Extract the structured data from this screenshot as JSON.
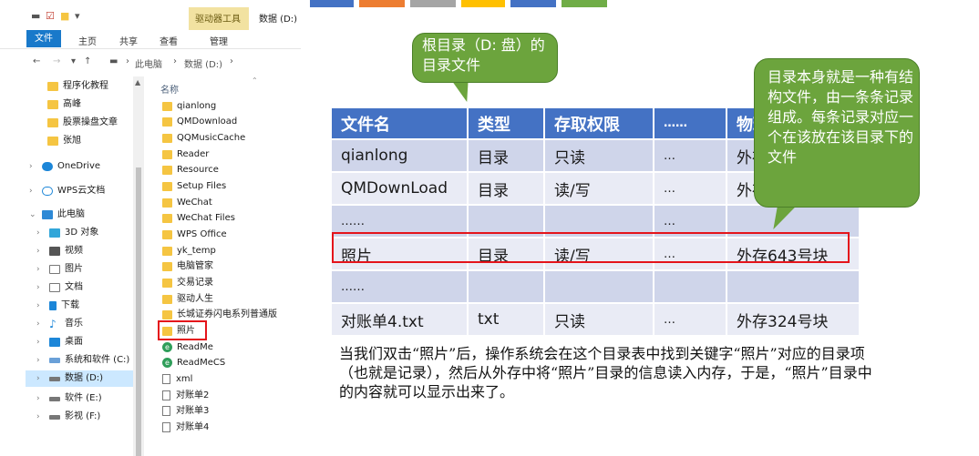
{
  "colors": {
    "accent_file_tab": "#1979ca",
    "table_header": "#4472c4",
    "table_row_odd": "#cfd5ea",
    "table_row_even": "#e9ebf5",
    "callout_green": "#6ca43d",
    "highlight_red": "#e4141b",
    "top_tabs": [
      "#4472c4",
      "#ed7d31",
      "#a5a5a5",
      "#ffc000",
      "#4472c4",
      "#70ad47"
    ]
  },
  "explorer": {
    "title_bar": {
      "quick_access_icons": [
        "save-icon",
        "properties-icon",
        "new-folder-icon",
        "customize-icon"
      ],
      "drive_tools": "驱动器工具",
      "window_title": "数据 (D:)"
    },
    "ribbon_tabs": {
      "file": "文件",
      "home": "主页",
      "share": "共享",
      "view": "查看",
      "manage": "管理"
    },
    "address": {
      "this_pc": "此电脑",
      "sep1": "›",
      "drive": "数据 (D:)",
      "sep2": "›"
    },
    "nav": [
      {
        "label": "程序化教程",
        "icon": "folder-icon"
      },
      {
        "label": "高峰",
        "icon": "folder-icon"
      },
      {
        "label": "股票操盘文章",
        "icon": "folder-icon"
      },
      {
        "label": "张旭",
        "icon": "folder-icon"
      },
      {
        "label": "OneDrive",
        "icon": "cloud-icon"
      },
      {
        "label": "WPS云文档",
        "icon": "cloud-outline-icon"
      },
      {
        "label": "此电脑",
        "icon": "computer-icon"
      },
      {
        "label": "3D 对象",
        "icon": "cube-icon"
      },
      {
        "label": "视频",
        "icon": "video-icon"
      },
      {
        "label": "图片",
        "icon": "picture-icon"
      },
      {
        "label": "文档",
        "icon": "document-icon"
      },
      {
        "label": "下载",
        "icon": "download-icon"
      },
      {
        "label": "音乐",
        "icon": "music-icon"
      },
      {
        "label": "桌面",
        "icon": "desktop-icon"
      },
      {
        "label": "系统和软件 (C:)",
        "icon": "windows-drive-icon"
      },
      {
        "label": "数据 (D:)",
        "icon": "drive-icon"
      },
      {
        "label": "软件 (E:)",
        "icon": "drive-icon"
      },
      {
        "label": "影视 (F:)",
        "icon": "drive-icon"
      }
    ],
    "list_header": "名称",
    "files": [
      {
        "name": "qianlong",
        "type": "folder"
      },
      {
        "name": "QMDownload",
        "type": "folder"
      },
      {
        "name": "QQMusicCache",
        "type": "folder"
      },
      {
        "name": "Reader",
        "type": "folder"
      },
      {
        "name": "Resource",
        "type": "folder"
      },
      {
        "name": "Setup Files",
        "type": "folder"
      },
      {
        "name": "WeChat",
        "type": "folder"
      },
      {
        "name": "WeChat Files",
        "type": "folder"
      },
      {
        "name": "WPS Office",
        "type": "folder"
      },
      {
        "name": "yk_temp",
        "type": "folder"
      },
      {
        "name": "电脑管家",
        "type": "folder"
      },
      {
        "name": "交易记录",
        "type": "folder"
      },
      {
        "name": "驱动人生",
        "type": "folder"
      },
      {
        "name": "长城证券闪电系列普通版",
        "type": "folder"
      },
      {
        "name": "照片",
        "type": "folder"
      },
      {
        "name": "ReadMe",
        "type": "link"
      },
      {
        "name": "ReadMeCS",
        "type": "link"
      },
      {
        "name": "xml",
        "type": "file"
      },
      {
        "name": "对账单2",
        "type": "file"
      },
      {
        "name": "对账单3",
        "type": "file"
      },
      {
        "name": "对账单4",
        "type": "file"
      }
    ]
  },
  "callouts": {
    "root": "根目录（D: 盘）的目录文件",
    "directory": "目录本身就是一种有结构文件，由一条条记录组成。每条记录对应一个在该放在该目录下的文件"
  },
  "table": {
    "headers": [
      "文件名",
      "类型",
      "存取权限",
      "……",
      "物理位置"
    ],
    "rows": [
      [
        "qianlong",
        "目录",
        "只读",
        "…",
        "外存"
      ],
      [
        "QMDownLoad",
        "目录",
        "读/写",
        "…",
        "外存"
      ],
      [
        "……",
        "",
        "",
        "…",
        ""
      ],
      [
        "照片",
        "目录",
        "读/写",
        "…",
        "外存643号块"
      ],
      [
        "……",
        "",
        "",
        "",
        ""
      ],
      [
        "对账单4.txt",
        "txt",
        "只读",
        "…",
        "外存324号块"
      ]
    ]
  },
  "explanation": "当我们双击“照片”后，操作系统会在这个目录表中找到关键字“照片”对应的目录项（也就是记录），然后从外存中将“照片”目录的信息读入内存，于是，“照片”目录中的内容就可以显示出来了。"
}
